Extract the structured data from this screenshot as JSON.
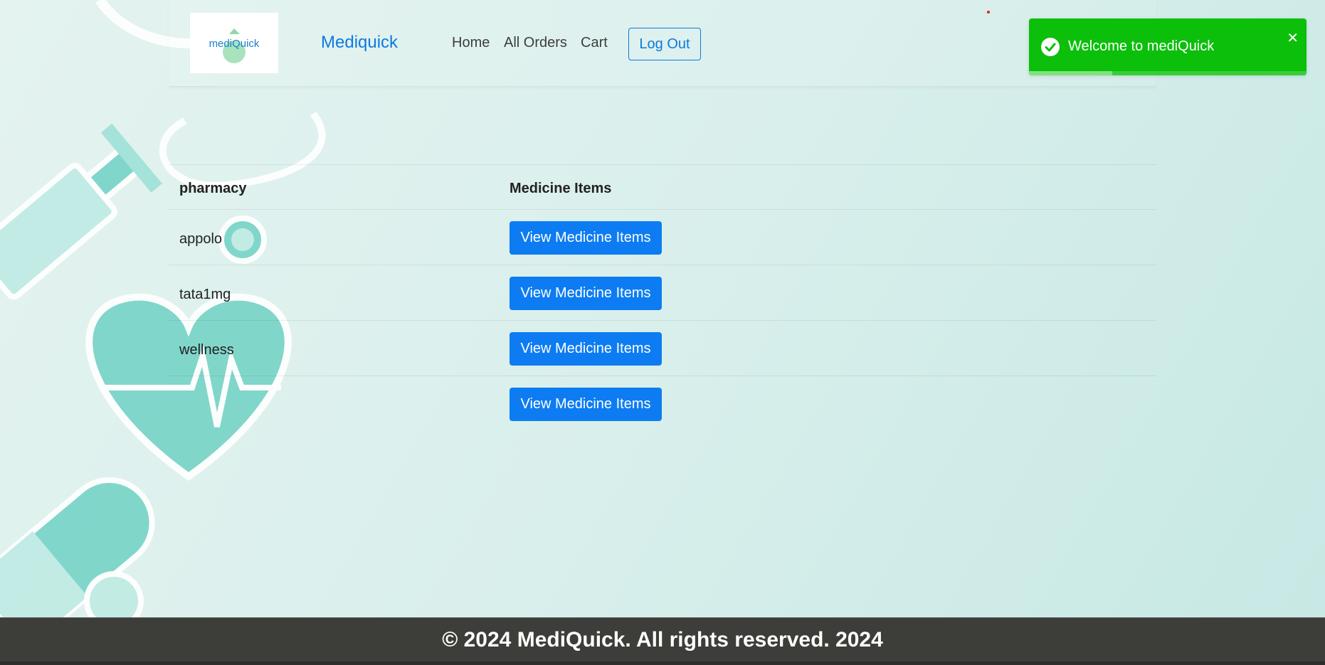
{
  "navbar": {
    "logo_text": "mediQuick",
    "brand": "Mediquick",
    "links": [
      "Home",
      "All Orders",
      "Cart"
    ],
    "logout_label": "Log Out"
  },
  "table": {
    "headers": [
      "pharmacy",
      "Medicine Items"
    ],
    "rows": [
      {
        "pharmacy": "appolo",
        "action": "View Medicine Items"
      },
      {
        "pharmacy": "tata1mg",
        "action": "View Medicine Items"
      },
      {
        "pharmacy": "wellness",
        "action": "View Medicine Items"
      },
      {
        "pharmacy": "",
        "action": "View Medicine Items"
      }
    ]
  },
  "toast": {
    "message": "Welcome to mediQuick",
    "close": "✕",
    "progress": 0.3,
    "color": "#0bbf0b"
  },
  "footer": {
    "text": "© 2024 MediQuick. All rights reserved. 2024"
  },
  "colors": {
    "accent": "#0d7cf2",
    "footer_bg": "#3d3d3a",
    "art": "#77d3c7"
  }
}
